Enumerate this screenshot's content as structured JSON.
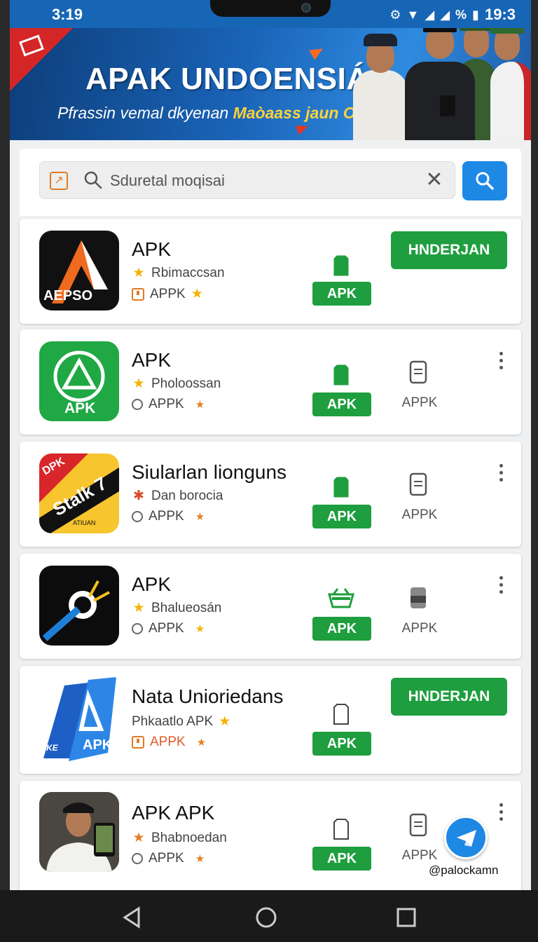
{
  "status_bar": {
    "time": "3:19",
    "clock": "19:3",
    "battery": "%"
  },
  "banner": {
    "title": "APAK UNDOENSIÁ",
    "subtitle_main": "Pfrassin vemal dkyenan",
    "subtitle_highlight": "Maòaass jaun Oeıı"
  },
  "search": {
    "placeholder": "Sduretal moqisai",
    "clear_glyph": "✕"
  },
  "apps": [
    {
      "title": "APK",
      "icon_text": "AEPSO",
      "meta1": "Rbimaccsan",
      "meta2": "APPK",
      "badge": "APK",
      "action": "HNDERJAN"
    },
    {
      "title": "APK",
      "icon_text": "APK",
      "meta1": "Pholoossan",
      "meta2": "APPK",
      "badge": "APK",
      "side_label": "APPK"
    },
    {
      "title": "Siularlan lionguns",
      "icon_text": "Stalk 7",
      "icon_corner": "DPK",
      "icon_small": "ATIUAN",
      "meta1": "Dan borocia",
      "meta2": "APPK",
      "badge": "APK",
      "side_label": "APPK"
    },
    {
      "title": "APK",
      "meta1": "Bhalueosán",
      "meta2": "APPK",
      "badge": "APK",
      "side_label": "APPK"
    },
    {
      "title": "Nata Unioriedans",
      "icon_text": "APK",
      "icon_side": "KE",
      "meta1": "Phkaatlo APK",
      "meta2": "APPK",
      "badge": "APK",
      "action": "HNDERJAN"
    },
    {
      "title": "APK APK",
      "meta1": "Bhabnoedan",
      "meta2": "APPK",
      "badge": "APK",
      "side_label": "APPK"
    }
  ],
  "watermark": "@palockamn",
  "colors": {
    "primary_blue": "#1e88e5",
    "green": "#1e9e3e",
    "banner_red": "#d42626",
    "highlight_yellow": "#ffd23a"
  }
}
